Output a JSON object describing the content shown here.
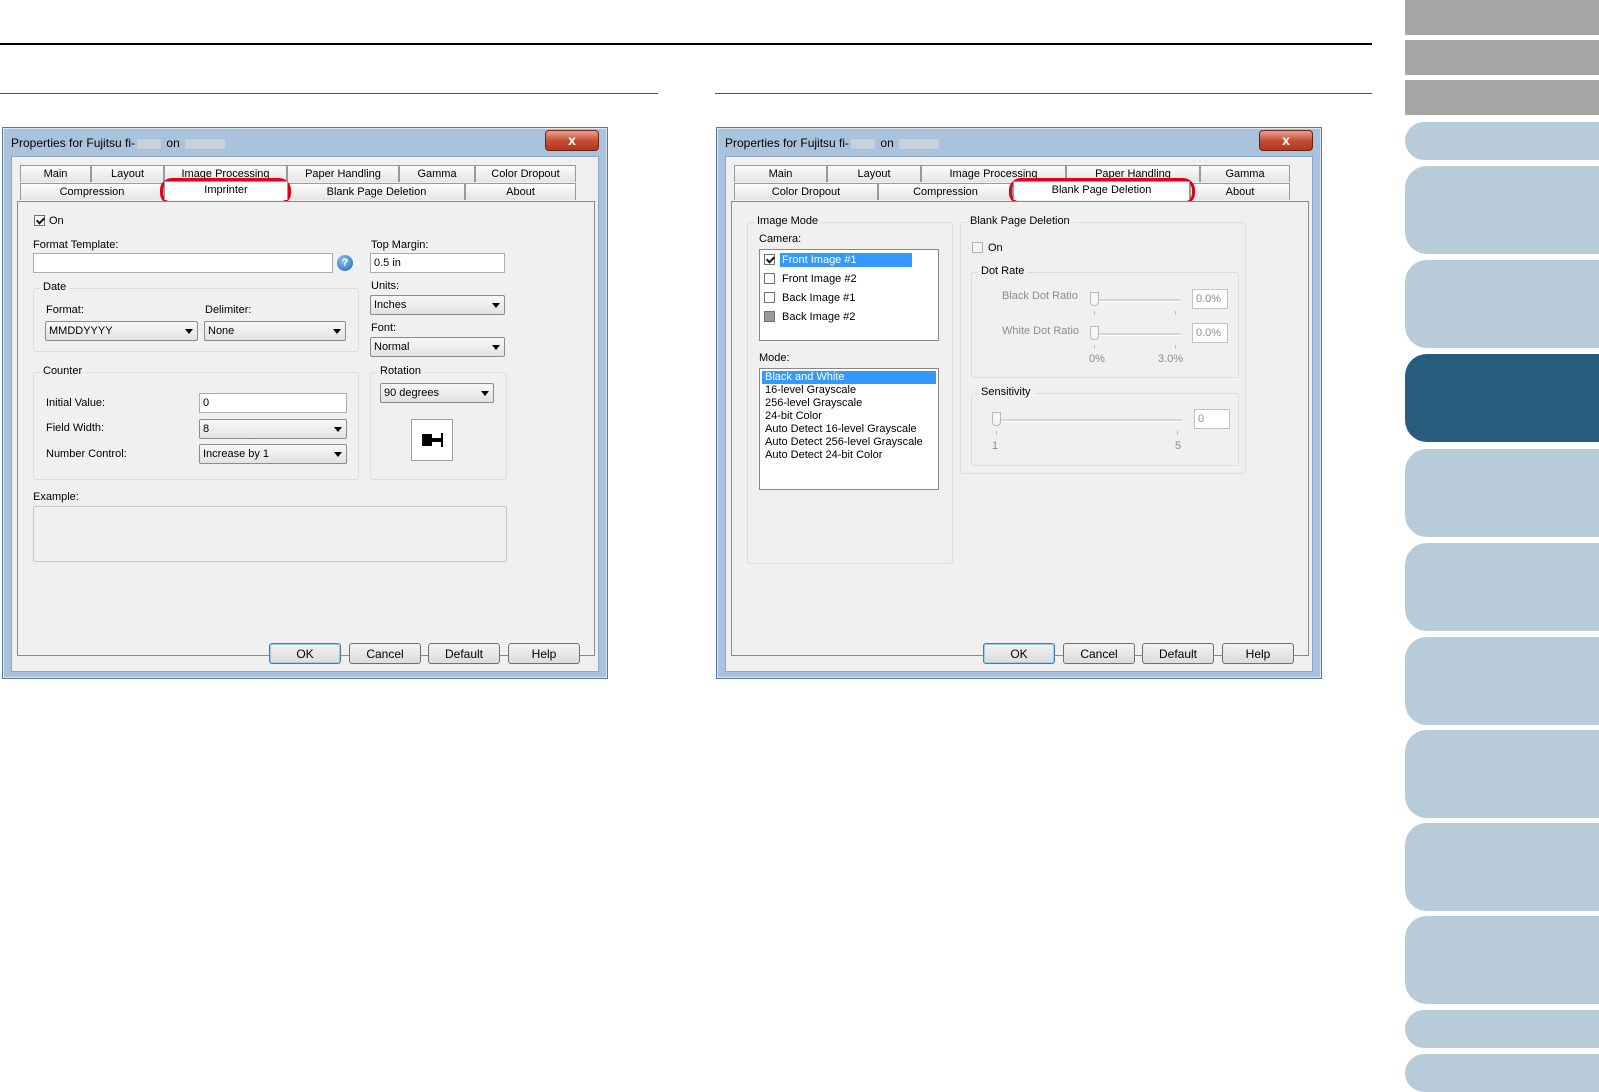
{
  "nav": {
    "colors": {
      "gray": "#a6a6a6",
      "blue": "#b7cbd8",
      "active": "#275c7c"
    }
  },
  "left_dialog": {
    "title_prefix": "Properties for Fujitsu fi-",
    "title_on": "on",
    "close_label": "x",
    "tabs_row1": [
      "Main",
      "Layout",
      "Image Processing",
      "Paper Handling",
      "Gamma",
      "Color Dropout"
    ],
    "tabs_row2": [
      "Compression",
      "Imprinter",
      "Blank Page Deletion",
      "About"
    ],
    "on_label": "On",
    "format_template_label": "Format Template:",
    "format_template_value": "",
    "help_glyph": "?",
    "top_margin_label": "Top Margin:",
    "top_margin_value": "0.5 in",
    "units_label": "Units:",
    "units_value": "Inches",
    "font_label": "Font:",
    "font_value": "Normal",
    "date_group": "Date",
    "format_label": "Format:",
    "format_value": "MMDDYYYY",
    "delimiter_label": "Delimiter:",
    "delimiter_value": "None",
    "counter_group": "Counter",
    "initial_value_label": "Initial Value:",
    "initial_value": "0",
    "field_width_label": "Field Width:",
    "field_width_value": "8",
    "number_control_label": "Number Control:",
    "number_control_value": "Increase by 1",
    "rotation_group": "Rotation",
    "rotation_value": "90 degrees",
    "example_label": "Example:",
    "buttons": {
      "ok": "OK",
      "cancel": "Cancel",
      "default": "Default",
      "help": "Help"
    }
  },
  "right_dialog": {
    "title_prefix": "Properties for Fujitsu fi-",
    "title_on": "on",
    "close_label": "x",
    "tabs_row1": [
      "Main",
      "Layout",
      "Image Processing",
      "Paper Handling",
      "Gamma"
    ],
    "tabs_row2": [
      "Color Dropout",
      "Compression",
      "Blank Page Deletion",
      "About"
    ],
    "image_mode_group": "Image Mode",
    "camera_label": "Camera:",
    "camera_items": [
      {
        "label": "Front Image #1",
        "checked": true,
        "selected": true
      },
      {
        "label": "Front Image #2",
        "checked": false,
        "selected": false
      },
      {
        "label": "Back Image #1",
        "checked": false,
        "selected": false
      },
      {
        "label": "Back Image #2",
        "checked": false,
        "selected": false,
        "grayed": true
      }
    ],
    "mode_label": "Mode:",
    "mode_items": [
      "Black and White",
      "16-level Grayscale",
      "256-level Grayscale",
      "24-bit Color",
      "Auto Detect 16-level Grayscale",
      "Auto Detect 256-level Grayscale",
      "Auto Detect 24-bit Color"
    ],
    "mode_selected": 0,
    "bpd_group": "Blank Page Deletion",
    "on_label": "On",
    "dot_rate_group": "Dot Rate",
    "black_dot_ratio_label": "Black Dot Ratio",
    "black_dot_ratio_value": "0.0%",
    "white_dot_ratio_label": "White Dot Ratio",
    "white_dot_ratio_value": "0.0%",
    "dot_min": "0%",
    "dot_max": "3.0%",
    "sensitivity_group": "Sensitivity",
    "sensitivity_value": "0",
    "sens_min": "1",
    "sens_max": "5",
    "buttons": {
      "ok": "OK",
      "cancel": "Cancel",
      "default": "Default",
      "help": "Help"
    }
  }
}
